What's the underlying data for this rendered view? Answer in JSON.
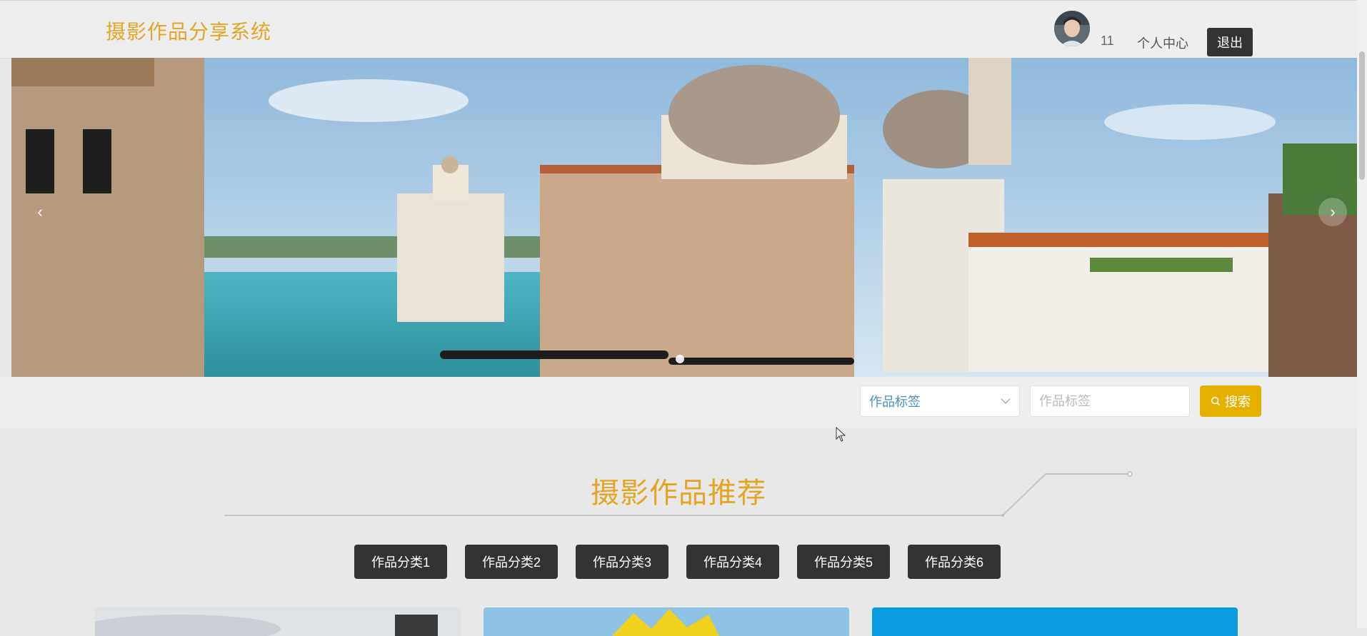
{
  "header": {
    "brand": "摄影作品分享系统",
    "username": "11",
    "profile_link": "个人中心",
    "logout_label": "退出"
  },
  "banner": {
    "prev_icon": "chevron-left-icon",
    "next_icon": "chevron-right-icon",
    "prev_glyph": "‹",
    "next_glyph": "›",
    "slide_count": 1
  },
  "search": {
    "select_value": "作品标签",
    "input_placeholder": "作品标签",
    "button_label": "搜索",
    "button_color": "#e6b000"
  },
  "recommend": {
    "title": "摄影作品推荐",
    "categories": [
      "作品分类1",
      "作品分类2",
      "作品分类3",
      "作品分类4",
      "作品分类5",
      "作品分类6"
    ]
  },
  "colors": {
    "brand": "#e4a527",
    "dark_button": "#333333",
    "page_bg": "#e8e8e8"
  }
}
